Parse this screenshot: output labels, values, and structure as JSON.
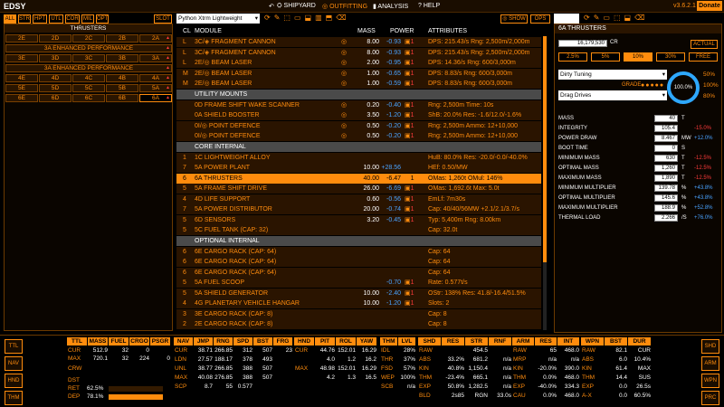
{
  "topbar": {
    "logo": "EDSY",
    "nav": [
      "SHIPYARD",
      "OUTFITTING",
      "ANALYSIS",
      "HELP"
    ],
    "version": "v3.6.2.1",
    "donate": "Donate"
  },
  "filters": [
    "ALL",
    "STR",
    "HPT",
    "UTL",
    "COR",
    "MIL",
    "OPT"
  ],
  "slot_btn": "SLOT",
  "ship_select": "Python Xtrm Lightweight",
  "show_btn": "SHOW",
  "ops_btn": "OPS",
  "left": {
    "title": "THRUSTERS",
    "rows": [
      [
        "2E",
        "2D",
        "2C",
        "2B",
        "2A"
      ],
      [
        "3A ENHANCED PERFORMANCE"
      ],
      [
        "3E",
        "3D",
        "3C",
        "3B",
        "3A"
      ],
      [
        "3A ENHANCED PERFORMANCE"
      ],
      [
        "4E",
        "4D",
        "4C",
        "4B",
        "4A"
      ],
      [
        "5E",
        "5D",
        "5C",
        "5B",
        "5A"
      ],
      [
        "6E",
        "6D",
        "6C",
        "6B",
        "6A"
      ]
    ]
  },
  "table": {
    "headers": [
      "CL",
      "MODULE",
      "MASS",
      "POWER",
      "ATTRIBUTES"
    ],
    "rows": [
      {
        "t": "m",
        "cl": "L",
        "name": "3C/◈ FRAGMENT CANNON",
        "mass": "8.00",
        "pow": "-0.93",
        "pri": "1",
        "attr": "DPS: 215.43/s Rng: 2,500m/2,000m"
      },
      {
        "t": "m",
        "cl": "L",
        "name": "3C/◈ FRAGMENT CANNON",
        "mass": "8.00",
        "pow": "-0.93",
        "pri": "1",
        "attr": "DPS: 215.43/s Rng: 2,500m/2,000m"
      },
      {
        "t": "m",
        "cl": "L",
        "name": "2E/◎ BEAM LASER",
        "mass": "2.00",
        "pow": "-0.95",
        "pri": "1",
        "attr": "DPS: 14.36/s Rng: 600/3,000m"
      },
      {
        "t": "m",
        "cl": "M",
        "name": "2E/◎ BEAM LASER",
        "mass": "1.00",
        "pow": "-0.65",
        "pri": "1",
        "attr": "DPS: 8.83/s Rng: 600/3,000m"
      },
      {
        "t": "m",
        "cl": "M",
        "name": "2E/◎ BEAM LASER",
        "mass": "1.00",
        "pow": "-0.59",
        "pri": "1",
        "attr": "DPS: 8.83/s Rng: 600/3,000m"
      },
      {
        "t": "s",
        "name": "UTILITY MOUNTS"
      },
      {
        "t": "m",
        "cl": "",
        "name": "0D FRAME SHIFT WAKE SCANNER",
        "mass": "0.20",
        "pow": "-0.40",
        "pri": "1",
        "attr": "Rng: 2,500m Time: 10s"
      },
      {
        "t": "m",
        "cl": "",
        "name": "0A SHIELD BOOSTER",
        "mass": "3.50",
        "pow": "-1.20",
        "pri": "1",
        "attr": "ShB: 20.0% Res: -1.6/12.0/-1.6%"
      },
      {
        "t": "m",
        "cl": "",
        "name": "0I/◎ POINT DEFENCE",
        "mass": "0.50",
        "pow": "-0.20",
        "pri": "1",
        "attr": "Rng: 2,500m Ammo: 12+10,000"
      },
      {
        "t": "m",
        "cl": "",
        "name": "0I/◎ POINT DEFENCE",
        "mass": "0.50",
        "pow": "-0.20",
        "pri": "1",
        "attr": "Rng: 2,500m Ammo: 12+10,000"
      },
      {
        "t": "s",
        "name": "CORE INTERNAL"
      },
      {
        "t": "m",
        "cl": "1",
        "name": "1C LIGHTWEIGHT ALLOY",
        "mass": "",
        "pow": "",
        "pri": "",
        "attr": "HuB: 80.0% Res: -20.0/-0.0/-40.0%"
      },
      {
        "t": "m",
        "cl": "7",
        "name": "5A POWER PLANT",
        "mass": "10.00",
        "pow": "+28.56",
        "pri": "",
        "attr": "HEf: 0.50/MW"
      },
      {
        "t": "m",
        "cl": "6",
        "name": "6A THRUSTERS",
        "mass": "40.00",
        "pow": "-6.47",
        "pri": "1",
        "attr": "OMas: 1,260t OMul: 146%",
        "sel": true
      },
      {
        "t": "m",
        "cl": "5",
        "name": "5A FRAME SHIFT DRIVE",
        "mass": "26.00",
        "pow": "-6.69",
        "pri": "1",
        "attr": "OMas: 1,692.6t Max: 5.0t"
      },
      {
        "t": "m",
        "cl": "4",
        "name": "4D LIFE SUPPORT",
        "mass": "0.60",
        "pow": "-0.56",
        "pri": "1",
        "attr": "EmLf: 7m30s"
      },
      {
        "t": "m",
        "cl": "7",
        "name": "5A POWER DISTRIBUTOR",
        "mass": "20.00",
        "pow": "-0.74",
        "pri": "1",
        "attr": "Cap: 40/40/56MW +2.1/2.1/3.7/s"
      },
      {
        "t": "m",
        "cl": "5",
        "name": "6D SENSORS",
        "mass": "3.20",
        "pow": "-0.45",
        "pri": "1",
        "attr": "Typ: 5,400m Rng: 8.00km"
      },
      {
        "t": "m",
        "cl": "5",
        "name": "5C FUEL TANK (CAP: 32)",
        "mass": "",
        "pow": "",
        "pri": "",
        "attr": "Cap: 32.0t"
      },
      {
        "t": "s",
        "name": "OPTIONAL INTERNAL"
      },
      {
        "t": "m",
        "cl": "6",
        "name": "6E CARGO RACK (CAP: 64)",
        "mass": "",
        "pow": "",
        "pri": "",
        "attr": "Cap: 64"
      },
      {
        "t": "m",
        "cl": "6",
        "name": "6E CARGO RACK (CAP: 64)",
        "mass": "",
        "pow": "",
        "pri": "",
        "attr": "Cap: 64"
      },
      {
        "t": "m",
        "cl": "6",
        "name": "6E CARGO RACK (CAP: 64)",
        "mass": "",
        "pow": "",
        "pri": "",
        "attr": "Cap: 64"
      },
      {
        "t": "m",
        "cl": "5",
        "name": "5A FUEL SCOOP",
        "mass": "",
        "pow": "-0.70",
        "pri": "1",
        "attr": "Rate: 0.577t/s"
      },
      {
        "t": "m",
        "cl": "5",
        "name": "5A SHIELD GENERATOR",
        "mass": "10.00",
        "pow": "-2.40",
        "pri": "1",
        "attr": "OStr: 138% Res: 41.8/-16.4/51.5%"
      },
      {
        "t": "m",
        "cl": "4",
        "name": "4G PLANETARY VEHICLE HANGAR",
        "mass": "10.00",
        "pow": "-1.20",
        "pri": "1",
        "attr": "Slots: 2"
      },
      {
        "t": "m",
        "cl": "3",
        "name": "3E CARGO RACK (CAP: 8)",
        "mass": "",
        "pow": "",
        "pri": "",
        "attr": "Cap: 8"
      },
      {
        "t": "m",
        "cl": "2",
        "name": "2E CARGO RACK (CAP: 8)",
        "mass": "",
        "pow": "",
        "pri": "",
        "attr": "Cap: 8"
      }
    ]
  },
  "right": {
    "title": "6A THRUSTERS",
    "cost": "16,179,530",
    "cr": "CR",
    "actual": "ACTUAL",
    "discounts": [
      "2.5%",
      "5%",
      "10%",
      "30%",
      "FREE"
    ],
    "blueprint": "Dirty Tuning",
    "grade_label": "GRADE",
    "experimental": "Drag Drives",
    "pct_top": "50%",
    "pct_mid": "100%",
    "pct_bot": "80%",
    "gauge": "100.0%",
    "stats": [
      [
        "MASS",
        "40",
        "T",
        ""
      ],
      [
        "INTEGRITY",
        "105.4",
        "",
        "-15.0%"
      ],
      [
        "POWER DRAW",
        "8.467",
        "MW",
        "+12.0%"
      ],
      [
        "BOOT TIME",
        "0",
        "S",
        ""
      ],
      [
        "MINIMUM MASS",
        "630",
        "T",
        "-12.5%"
      ],
      [
        "OPTIMAL MASS",
        "1,260",
        "T",
        "-12.5%"
      ],
      [
        "MAXIMUM MASS",
        "1,890",
        "T",
        "-12.5%"
      ],
      [
        "MINIMUM MULTIPLIER",
        "139.78",
        "%",
        "+43.8%"
      ],
      [
        "OPTIMAL MULTIPLIER",
        "145.6",
        "%",
        "+43.8%"
      ],
      [
        "MAXIMUM MULTIPLIER",
        "188.9",
        "%",
        "+52.8%"
      ],
      [
        "THERMAL LOAD",
        "2.266",
        "/S",
        "+76.0%"
      ]
    ]
  },
  "bottom": {
    "side_left": [
      "TTL",
      "NAV",
      "HND",
      "THM"
    ],
    "side_right": [
      "SHD",
      "ARM",
      "WPN",
      "PRC"
    ],
    "ttl": {
      "h": [
        "TTL",
        "MASS",
        "FUEL",
        "CRGO",
        "PSGR"
      ],
      "r": [
        [
          "CUR",
          "512.9",
          "32",
          "0",
          ""
        ],
        [
          "MAX",
          "720.1",
          "32",
          "224",
          "0"
        ]
      ],
      "crw": "CRW",
      "dst": "DST",
      "dep": "DEP",
      "ret": "RET",
      "ret_v": "62.5%",
      "dep_v": "78.1%"
    },
    "nav": {
      "h": [
        "NAV",
        "JMP",
        "RNG",
        "SPD",
        "BST",
        "FRG"
      ],
      "r": [
        [
          "CUR",
          "38.71",
          "266.85",
          "312",
          "507",
          "23"
        ],
        [
          "LDN",
          "27.57",
          "188.17",
          "378",
          "493",
          ""
        ],
        [
          "UNL",
          "38.77",
          "266.85",
          "388",
          "507",
          ""
        ],
        [
          "MAX",
          "40.08",
          "276.85",
          "388",
          "507",
          ""
        ],
        [
          "SCP",
          "8.7",
          "55",
          "0.577",
          "",
          ""
        ]
      ]
    },
    "hnd": {
      "h": [
        "HND",
        "PIT",
        "ROL",
        "YAW"
      ],
      "r": [
        [
          "CUR",
          "44.76",
          "152.01",
          "16.29"
        ],
        [
          "",
          "4.0",
          "1.2",
          "16.2"
        ],
        [
          "MAX",
          "48.98",
          "152.01",
          "16.29"
        ],
        [
          "",
          "4.2",
          "1.3",
          "16.5"
        ]
      ]
    },
    "thm": {
      "h": [
        "THM",
        "LVL"
      ],
      "r": [
        [
          "IDL",
          "28%"
        ],
        [
          "THR",
          "37%"
        ],
        [
          "FSD",
          "57%"
        ],
        [
          "WEP",
          "100%"
        ],
        [
          "SCB",
          "n/a"
        ]
      ]
    },
    "shd": {
      "h": [
        "SHD",
        "RES",
        "STR",
        "RNF"
      ],
      "r": [
        [
          "RAW",
          "",
          "454.5",
          ""
        ],
        [
          "ABS",
          "33.2%",
          "681.2",
          "n/a"
        ],
        [
          "KIN",
          "40.8%",
          "1,150.4",
          "n/a"
        ],
        [
          "THM",
          "-23.4%",
          "665.1",
          "n/a"
        ],
        [
          "EXP",
          "50.8%",
          "1,282.5",
          "n/a"
        ],
        [
          "BLD",
          "2s85",
          "RGN",
          "33.0s"
        ]
      ]
    },
    "arm": {
      "h": [
        "ARM",
        "RES",
        "INT"
      ],
      "r": [
        [
          "RAW",
          "65",
          "468.0"
        ],
        [
          "MRP",
          "n/a",
          "n/a"
        ],
        [
          "KIN",
          "-20.0%",
          "390.0"
        ],
        [
          "THM",
          "0.0%",
          "468.0"
        ],
        [
          "EXP",
          "-40.0%",
          "334.3"
        ],
        [
          "CAU",
          "0.0%",
          "468.0"
        ]
      ]
    },
    "wpn": {
      "h": [
        "WPN",
        "BST",
        "DUR"
      ],
      "r": [
        [
          "RAW",
          "82.1",
          "CUR"
        ],
        [
          "ABS",
          "6.0",
          "10.4%"
        ],
        [
          "KIN",
          "61.4",
          "MAX"
        ],
        [
          "THM",
          "14.4",
          "SUS"
        ],
        [
          "EXP",
          "0.0",
          "26.5s"
        ],
        [
          "A-X",
          "0.0",
          "60.5%"
        ]
      ]
    }
  }
}
